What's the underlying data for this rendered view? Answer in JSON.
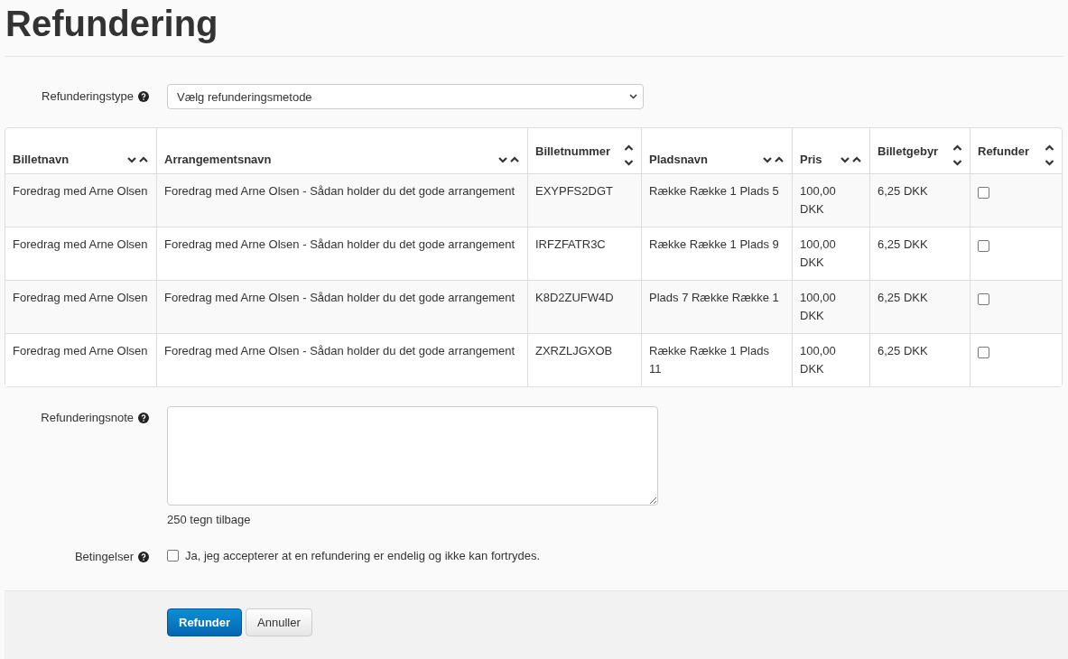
{
  "title": "Refundering",
  "refund_type": {
    "label": "Refunderingstype",
    "value": "Vælg refunderingsmetode"
  },
  "table": {
    "columns": [
      {
        "label": "Billetnavn",
        "kind": "inline"
      },
      {
        "label": "Arrangementsnavn",
        "kind": "inline"
      },
      {
        "label": "Billetnummer",
        "kind": "stacked"
      },
      {
        "label": "Pladsnavn",
        "kind": "inline"
      },
      {
        "label": "Pris",
        "kind": "inline"
      },
      {
        "label": "Billetgebyr",
        "kind": "stacked"
      },
      {
        "label": "Refunder",
        "kind": "stacked"
      }
    ],
    "rows": [
      {
        "cells": [
          "Foredrag med Arne Olsen",
          "Foredrag med Arne Olsen - Sådan holder du det gode arrangement",
          "EXYPFS2DGT",
          "Række Række 1 Plads 5",
          "100,00 DKK",
          "6,25 DKK"
        ],
        "checked": false
      },
      {
        "cells": [
          "Foredrag med Arne Olsen",
          "Foredrag med Arne Olsen - Sådan holder du det gode arrangement",
          "IRFZFATR3C",
          "Række Række 1 Plads 9",
          "100,00 DKK",
          "6,25 DKK"
        ],
        "checked": false
      },
      {
        "cells": [
          "Foredrag med Arne Olsen",
          "Foredrag med Arne Olsen - Sådan holder du det gode arrangement",
          "K8D2ZUFW4D",
          "Plads 7 Række Række 1",
          "100,00 DKK",
          "6,25 DKK"
        ],
        "checked": false
      },
      {
        "cells": [
          "Foredrag med Arne Olsen",
          "Foredrag med Arne Olsen - Sådan holder du det gode arrangement",
          "ZXRZLJGXOB",
          "Række Række 1 Plads 11",
          "100,00 DKK",
          "6,25 DKK"
        ],
        "checked": false
      }
    ]
  },
  "note": {
    "label": "Refunderingsnote",
    "counter": "250 tegn tilbage"
  },
  "terms": {
    "label": "Betingelser",
    "text": "Ja, jeg accepterer at en refundering er endelig og ikke kan fortrydes.",
    "checked": false
  },
  "buttons": [
    {
      "label": "Refunder",
      "kind": "primary"
    },
    {
      "label": "Annuller",
      "kind": "default"
    }
  ]
}
